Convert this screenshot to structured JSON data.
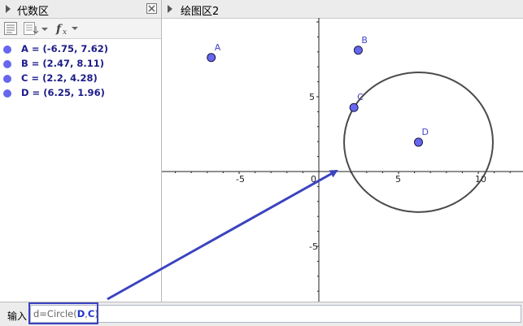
{
  "algebra": {
    "title": "代数区",
    "items": [
      {
        "name": "A",
        "label": "A = (-6.75, 7.62)",
        "x": -6.75,
        "y": 7.62
      },
      {
        "name": "B",
        "label": "B = (2.47, 8.11)",
        "x": 2.47,
        "y": 8.11
      },
      {
        "name": "C",
        "label": "C = (2.2, 4.28)",
        "x": 2.2,
        "y": 4.28
      },
      {
        "name": "D",
        "label": "D = (6.25, 1.96)",
        "x": 6.25,
        "y": 1.96
      }
    ],
    "point_color": "#6666ee"
  },
  "graphics": {
    "title": "绘图区2",
    "x_ticks": [
      "-5",
      "0",
      "5",
      "10"
    ],
    "y_ticks": [
      "5",
      "-5"
    ],
    "circle": {
      "center": "D",
      "through": "C"
    },
    "circle_color": "#4a4a4a",
    "axis_color": "#222222"
  },
  "input": {
    "label": "输入",
    "command_prefix": "d=Circle(",
    "arg1": "D",
    "separator": ",",
    "arg2": "C",
    "command_suffix": ")"
  },
  "annotation": {
    "arrow_color": "#3b43c0",
    "highlight_color": "#3b43c0"
  }
}
